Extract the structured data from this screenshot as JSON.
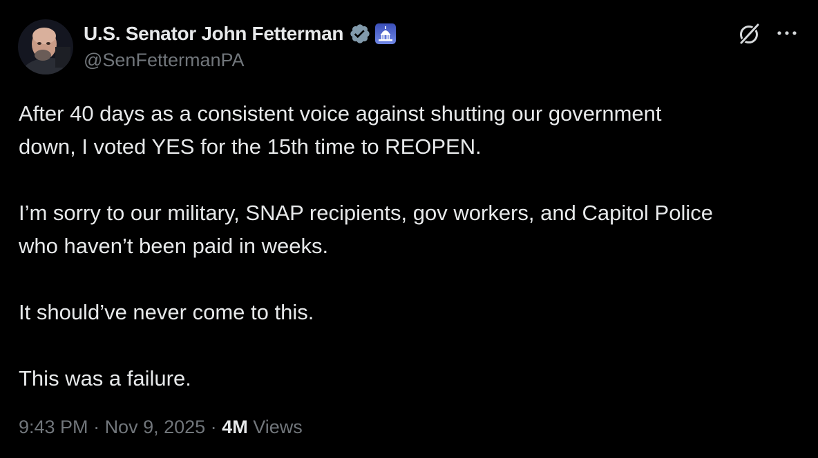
{
  "author": {
    "display_name": "U.S. Senator John Fetterman",
    "handle": "@SenFettermanPA",
    "avatar_icon": "user-avatar",
    "verified_badge_icon": "verified-badge-icon",
    "verified_badge_color": "#829aab",
    "affiliate_badge_icon": "capitol-badge-icon"
  },
  "actions": {
    "grok_icon": "grok-icon",
    "more_icon": "more-icon"
  },
  "tweet": {
    "paragraphs": [
      [
        "After 40 days as a consistent voice against shutting our government",
        "down, I voted YES for the 15th time to REOPEN."
      ],
      [
        "I’m sorry to our military, SNAP recipients, gov workers, and Capitol Police",
        "who haven’t been paid in weeks."
      ],
      [
        "It should’ve never come to this."
      ],
      [
        "This was a failure."
      ]
    ]
  },
  "meta": {
    "time": "9:43 PM",
    "separator": " · ",
    "date": "Nov 9, 2025",
    "views_count": "4M",
    "views_label": "Views"
  },
  "colors": {
    "background": "#000000",
    "primary_text": "#e7e9ea",
    "secondary_text": "#71767b"
  }
}
